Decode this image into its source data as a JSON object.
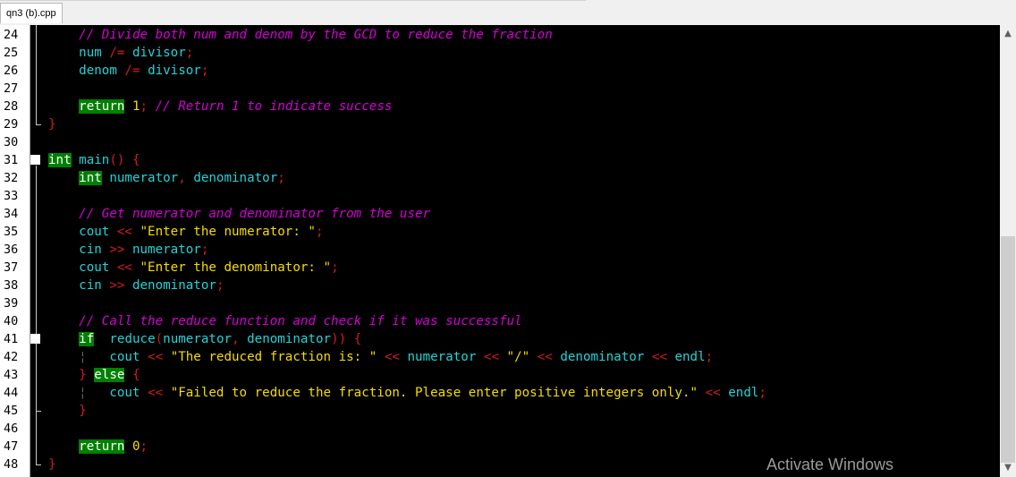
{
  "tab": {
    "label": "qn3 (b).cpp"
  },
  "lines": [
    {
      "n": "24",
      "tokens": [
        {
          "t": "    "
        },
        {
          "t": "// Divide both num and denom by the GCD to reduce the fraction",
          "c": "cm"
        }
      ]
    },
    {
      "n": "25",
      "tokens": [
        {
          "t": "    "
        },
        {
          "t": "num",
          "c": "id"
        },
        {
          "t": " /= ",
          "c": "op"
        },
        {
          "t": "divisor",
          "c": "id"
        },
        {
          "t": ";",
          "c": "op"
        }
      ]
    },
    {
      "n": "26",
      "tokens": [
        {
          "t": "    "
        },
        {
          "t": "denom",
          "c": "id"
        },
        {
          "t": " /= ",
          "c": "op"
        },
        {
          "t": "divisor",
          "c": "id"
        },
        {
          "t": ";",
          "c": "op"
        }
      ]
    },
    {
      "n": "27",
      "tokens": []
    },
    {
      "n": "28",
      "tokens": [
        {
          "t": "    "
        },
        {
          "t": "return",
          "c": "kw"
        },
        {
          "t": " "
        },
        {
          "t": "1",
          "c": "num"
        },
        {
          "t": "; ",
          "c": "op"
        },
        {
          "t": "// Return 1 to indicate success",
          "c": "cm"
        }
      ]
    },
    {
      "n": "29",
      "tokens": [
        {
          "t": "}",
          "c": "op"
        }
      ]
    },
    {
      "n": "30",
      "tokens": []
    },
    {
      "n": "31",
      "tokens": [
        {
          "t": "int",
          "c": "kw"
        },
        {
          "t": " "
        },
        {
          "t": "main",
          "c": "id"
        },
        {
          "t": "() {",
          "c": "op"
        }
      ]
    },
    {
      "n": "32",
      "tokens": [
        {
          "t": "    "
        },
        {
          "t": "int",
          "c": "kw"
        },
        {
          "t": " "
        },
        {
          "t": "numerator",
          "c": "id"
        },
        {
          "t": ", ",
          "c": "op"
        },
        {
          "t": "denominator",
          "c": "id"
        },
        {
          "t": ";",
          "c": "op"
        }
      ]
    },
    {
      "n": "33",
      "tokens": []
    },
    {
      "n": "34",
      "tokens": [
        {
          "t": "    "
        },
        {
          "t": "// Get numerator and denominator from the user",
          "c": "cm"
        }
      ]
    },
    {
      "n": "35",
      "tokens": [
        {
          "t": "    "
        },
        {
          "t": "cout",
          "c": "id"
        },
        {
          "t": " << ",
          "c": "op"
        },
        {
          "t": "\"Enter the numerator: \"",
          "c": "str"
        },
        {
          "t": ";",
          "c": "op"
        }
      ]
    },
    {
      "n": "36",
      "tokens": [
        {
          "t": "    "
        },
        {
          "t": "cin",
          "c": "id"
        },
        {
          "t": " >> ",
          "c": "op"
        },
        {
          "t": "numerator",
          "c": "id"
        },
        {
          "t": ";",
          "c": "op"
        }
      ]
    },
    {
      "n": "37",
      "tokens": [
        {
          "t": "    "
        },
        {
          "t": "cout",
          "c": "id"
        },
        {
          "t": " << ",
          "c": "op"
        },
        {
          "t": "\"Enter the denominator: \"",
          "c": "str"
        },
        {
          "t": ";",
          "c": "op"
        }
      ]
    },
    {
      "n": "38",
      "tokens": [
        {
          "t": "    "
        },
        {
          "t": "cin",
          "c": "id"
        },
        {
          "t": " >> ",
          "c": "op"
        },
        {
          "t": "denominator",
          "c": "id"
        },
        {
          "t": ";",
          "c": "op"
        }
      ]
    },
    {
      "n": "39",
      "tokens": []
    },
    {
      "n": "40",
      "tokens": [
        {
          "t": "    "
        },
        {
          "t": "// Call the reduce function and check if it was successful",
          "c": "cm"
        }
      ]
    },
    {
      "n": "41",
      "tokens": [
        {
          "t": "    "
        },
        {
          "t": "if",
          "c": "kw"
        },
        {
          "t": " ("
        },
        {
          "t": "reduce",
          "c": "id"
        },
        {
          "t": "(",
          "c": "op"
        },
        {
          "t": "numerator",
          "c": "id"
        },
        {
          "t": ", ",
          "c": "op"
        },
        {
          "t": "denominator",
          "c": "id"
        },
        {
          "t": ")) {",
          "c": "op"
        }
      ]
    },
    {
      "n": "42",
      "tokens": [
        {
          "t": "    "
        },
        {
          "t": "¦",
          "c": "guide"
        },
        {
          "t": "   "
        },
        {
          "t": "cout",
          "c": "id"
        },
        {
          "t": " << ",
          "c": "op"
        },
        {
          "t": "\"The reduced fraction is: \"",
          "c": "str"
        },
        {
          "t": " << ",
          "c": "op"
        },
        {
          "t": "numerator",
          "c": "id"
        },
        {
          "t": " << ",
          "c": "op"
        },
        {
          "t": "\"/\"",
          "c": "str"
        },
        {
          "t": " << ",
          "c": "op"
        },
        {
          "t": "denominator",
          "c": "id"
        },
        {
          "t": " << ",
          "c": "op"
        },
        {
          "t": "endl",
          "c": "id"
        },
        {
          "t": ";",
          "c": "op"
        }
      ]
    },
    {
      "n": "43",
      "tokens": [
        {
          "t": "    "
        },
        {
          "t": "} ",
          "c": "op"
        },
        {
          "t": "else",
          "c": "kw"
        },
        {
          "t": " {",
          "c": "op"
        }
      ]
    },
    {
      "n": "44",
      "tokens": [
        {
          "t": "    "
        },
        {
          "t": "¦",
          "c": "guide"
        },
        {
          "t": "   "
        },
        {
          "t": "cout",
          "c": "id"
        },
        {
          "t": " << ",
          "c": "op"
        },
        {
          "t": "\"Failed to reduce the fraction. Please enter positive integers only.\"",
          "c": "str"
        },
        {
          "t": " << ",
          "c": "op"
        },
        {
          "t": "endl",
          "c": "id"
        },
        {
          "t": ";",
          "c": "op"
        }
      ]
    },
    {
      "n": "45",
      "tokens": [
        {
          "t": "    "
        },
        {
          "t": "}",
          "c": "op"
        }
      ]
    },
    {
      "n": "46",
      "tokens": []
    },
    {
      "n": "47",
      "tokens": [
        {
          "t": "    "
        },
        {
          "t": "return",
          "c": "kw"
        },
        {
          "t": " "
        },
        {
          "t": "0",
          "c": "num"
        },
        {
          "t": ";",
          "c": "op"
        }
      ]
    },
    {
      "n": "48",
      "tokens": [
        {
          "t": "}",
          "c": "op"
        }
      ]
    }
  ],
  "fold_markers": [
    "31",
    "41"
  ],
  "scrollbar": {
    "up_icon": "chevron-up-icon",
    "down_icon": "chevron-down-icon"
  },
  "watermark": "Activate Windows",
  "colors": {
    "editor_bg": "#000000",
    "keyword_bg": "#008000",
    "identifier": "#22d3d8",
    "operator": "#d11d1d",
    "string_number": "#f5dc00",
    "comment": "#d400d4"
  }
}
